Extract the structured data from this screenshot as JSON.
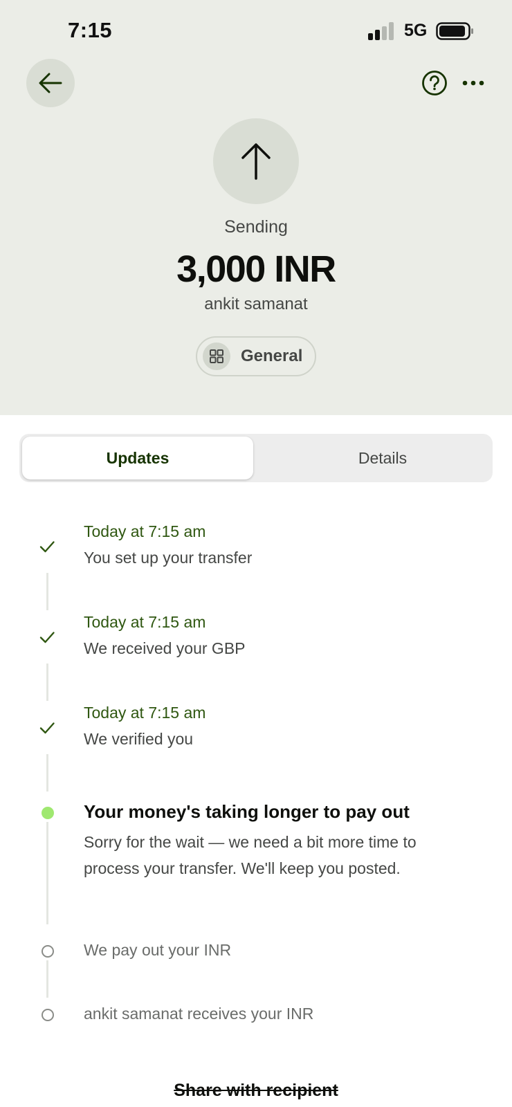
{
  "status_bar": {
    "time": "7:15",
    "network": "5G"
  },
  "header": {
    "back_icon": "arrow-left-icon",
    "help_icon": "question-circle-icon",
    "more_icon": "more-horizontal-icon"
  },
  "transfer": {
    "direction_icon": "arrow-up-icon",
    "status_label": "Sending",
    "amount": "3,000 INR",
    "recipient": "ankit samanat",
    "category": "General",
    "category_icon": "grid-icon"
  },
  "tabs": [
    {
      "label": "Updates",
      "selected": true
    },
    {
      "label": "Details",
      "selected": false
    }
  ],
  "timeline": [
    {
      "state": "done",
      "time": "Today at 7:15 am",
      "text": "You set up your transfer"
    },
    {
      "state": "done",
      "time": "Today at 7:15 am",
      "text": "We received your GBP"
    },
    {
      "state": "done",
      "time": "Today at 7:15 am",
      "text": "We verified you"
    },
    {
      "state": "active",
      "title": "Your money's taking longer to pay out",
      "body_line1": "Sorry for the wait — we need a bit more time to",
      "body_line2": "process your transfer. We'll keep you posted."
    },
    {
      "state": "pending",
      "text": "We pay out your INR"
    },
    {
      "state": "pending",
      "text": "ankit samanat receives your INR"
    }
  ],
  "share_label": "Share with recipient",
  "colors": {
    "hero_bg": "#ebede7",
    "accent_green": "#9fe870",
    "forest_green": "#163300",
    "time_green": "#2f5711"
  }
}
